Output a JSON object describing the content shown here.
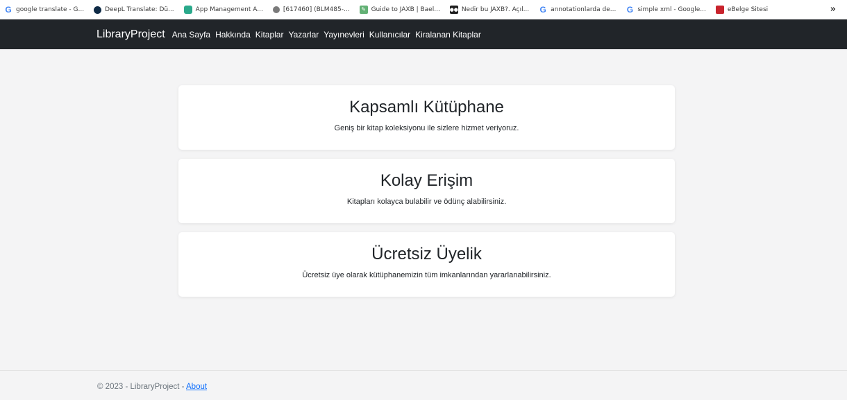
{
  "bookmarks": {
    "items": [
      {
        "label": "google translate - G...",
        "icon": "google-icon"
      },
      {
        "label": "DeepL Translate: Dü...",
        "icon": "deepl-icon"
      },
      {
        "label": "App Management A...",
        "icon": "app-management-icon"
      },
      {
        "label": "[617460] (BLM485-...",
        "icon": "shield-icon"
      },
      {
        "label": "Guide to JAXB | Bael...",
        "icon": "baeldung-icon"
      },
      {
        "label": "Nedir bu JAXB?. Açıl...",
        "icon": "medium-icon"
      },
      {
        "label": "annotationlarda de...",
        "icon": "google-icon"
      },
      {
        "label": "simple xml - Google...",
        "icon": "google-icon"
      },
      {
        "label": "eBelge Sitesi",
        "icon": "ebelge-icon"
      }
    ],
    "more": "»"
  },
  "navbar": {
    "brand": "LibraryProject",
    "links": [
      "Ana Sayfa",
      "Hakkında",
      "Kitaplar",
      "Yazarlar",
      "Yayınevleri",
      "Kullanıcılar",
      "Kiralanan Kitaplar"
    ]
  },
  "main": {
    "cards": [
      {
        "title": "Kapsamlı Kütüphane",
        "text": "Geniş bir kitap koleksiyonu ile sizlere hizmet veriyoruz."
      },
      {
        "title": "Kolay Erişim",
        "text": "Kitapları kolayca bulabilir ve ödünç alabilirsiniz."
      },
      {
        "title": "Ücretsiz Üyelik",
        "text": "Ücretsiz üye olarak kütüphanemizin tüm imkanlarından yararlanabilirsiniz."
      }
    ]
  },
  "footer": {
    "text": "© 2023 - LibraryProject - ",
    "link": "About"
  },
  "colors": {
    "navbar": "#212529",
    "background": "#f4f4f5",
    "link": "#0d6efd"
  }
}
